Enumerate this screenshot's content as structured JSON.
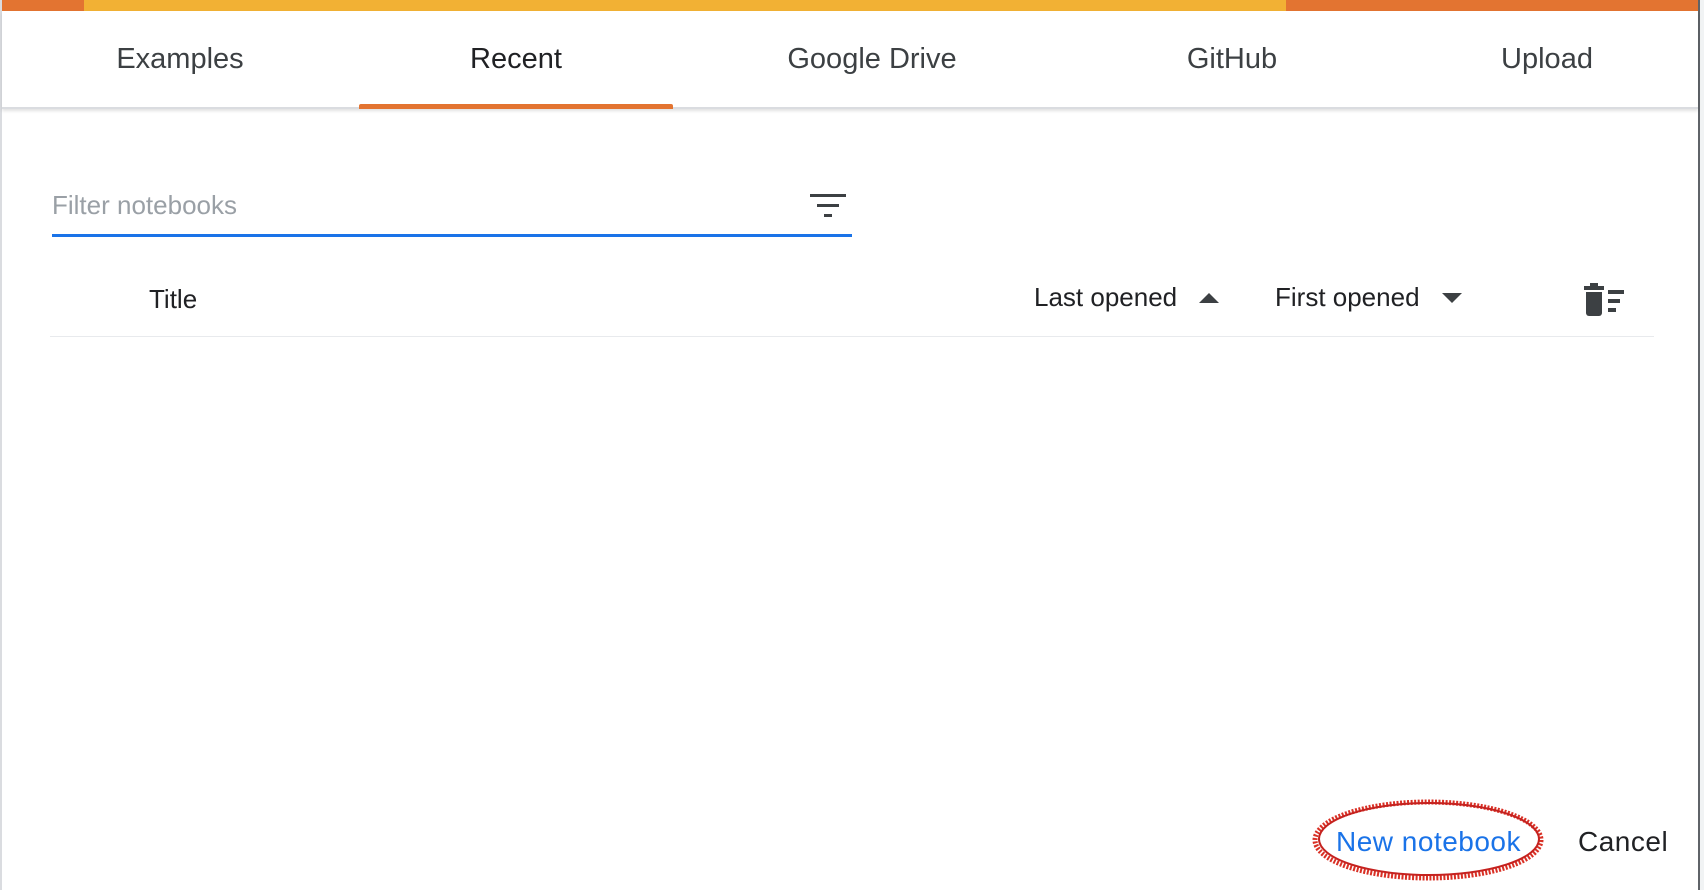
{
  "tabs": [
    {
      "label": "Examples",
      "active": false
    },
    {
      "label": "Recent",
      "active": true
    },
    {
      "label": "Google Drive",
      "active": false
    },
    {
      "label": "GitHub",
      "active": false
    },
    {
      "label": "Upload",
      "active": false
    }
  ],
  "filter": {
    "placeholder": "Filter notebooks",
    "value": ""
  },
  "table": {
    "columns": {
      "title": "Title",
      "last_opened": "Last opened",
      "first_opened": "First opened"
    },
    "rows": []
  },
  "actions": {
    "new_notebook": "New notebook",
    "cancel": "Cancel"
  },
  "colors": {
    "accent_orange": "#e37431",
    "accent_yellow": "#f2b134",
    "link_blue": "#1a73e8",
    "annotation_red": "#d93025"
  },
  "icons": {
    "filter": "filter-list-icon",
    "trash": "delete-sweep-icon",
    "sort_asc": "arrow-up-icon",
    "sort_desc": "arrow-down-icon"
  }
}
